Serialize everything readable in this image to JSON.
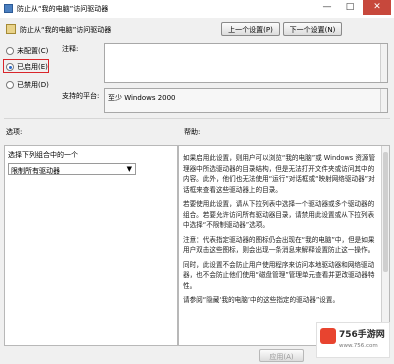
{
  "window": {
    "title": "防止从“我的电脑”访问驱动器",
    "minimize": "—",
    "maximize": "□",
    "close": "✕"
  },
  "header": {
    "setting_name": "防止从“我的电脑”访问驱动器",
    "prev_button": "上一个设置(P)",
    "next_button": "下一个设置(N)"
  },
  "state": {
    "options": [
      "未配置(C)",
      "已启用(E)",
      "已禁用(D)"
    ],
    "selected": "已启用(E)"
  },
  "labels": {
    "comment": "注释:",
    "supported_on": "支持的平台:",
    "supported_value": "至少 Windows 2000",
    "options": "选项:",
    "help": "帮助:"
  },
  "options_panel": {
    "prompt": "选择下列组合中的一个",
    "dropdown_value": "限制所有驱动器"
  },
  "help_text": [
    "如果启用此设置，则用户可以浏览“我的电脑”或 Windows 资源管理器中所选驱动器的目录结构，但是无法打开文件夹或访问其中的内容。此外，他们也无法使用“运行”对话框或“映射网络驱动器”对话框来查看这些驱动器上的目录。",
    "若要使用此设置，请从下拉列表中选择一个驱动器或多个驱动器的组合。若要允许访问所有驱动器目录，请禁用此设置或从下拉列表中选择“不限制驱动器”选项。",
    "注意：代表指定驱动器的图标仍会出现在“我的电脑”中，但是如果用户双击这些图标，则会出现一条消息来解释设置防止这一操作。",
    "同时，此设置不会防止用户使用程序来访问本地驱动器和网络驱动器，也不会防止他们使用“磁盘管理”管理单元查看并更改驱动器特性。",
    "请参阅“隐藏‘我的电脑’中的这些指定的驱动器”设置。"
  ],
  "footer": {
    "apply_button": "应用(A)"
  },
  "watermark": {
    "brand": "756手游网",
    "site": "www.756.com"
  }
}
